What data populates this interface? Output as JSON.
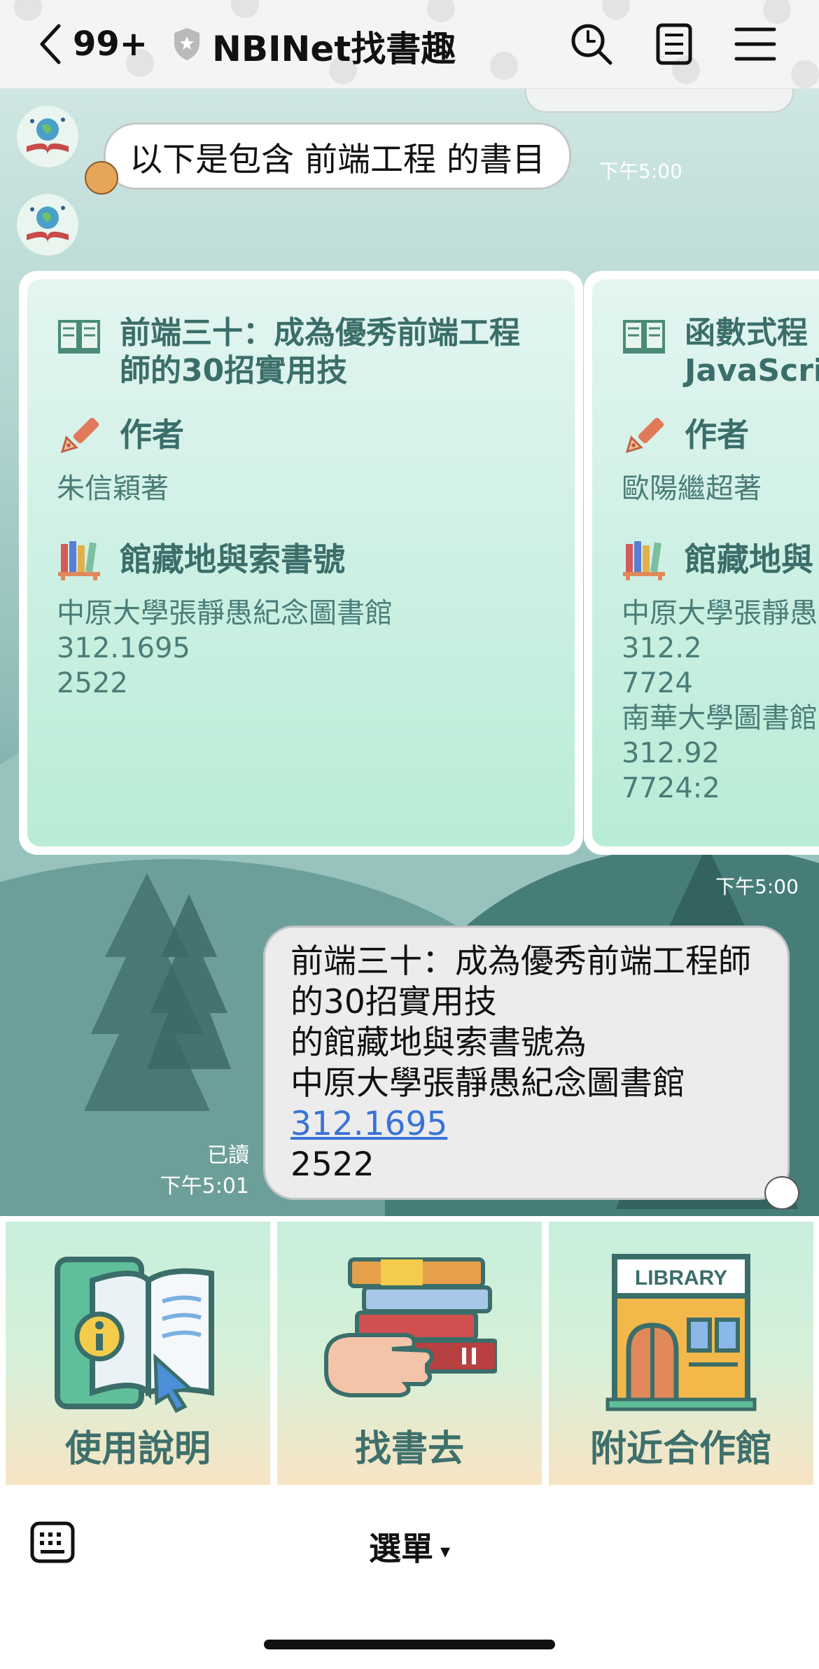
{
  "header": {
    "unread_count": "99+",
    "title": "NBINet找書趣"
  },
  "chat": {
    "bot_message": "以下是包含 前端工程 的書目",
    "bot_message_time": "下午5:00",
    "carousel_time": "下午5:00",
    "cards": [
      {
        "title": "前端三十：成為優秀前端工程師的30招實用技",
        "author_label": "作者",
        "author": "朱信穎著",
        "holdings_label": "館藏地與索書號",
        "holdings": [
          "中原大學張靜愚紀念圖書館",
          "312.1695",
          "2522"
        ]
      },
      {
        "title": "函數式程",
        "title_line2": "JavaScrip",
        "author_label": "作者",
        "author": "歐陽繼超著",
        "holdings_label": "館藏地與",
        "holdings": [
          "中原大學張靜愚",
          "312.2",
          "7724",
          "南華大學圖書館",
          "312.92",
          "7724:2"
        ]
      }
    ],
    "sent_message": {
      "lines": [
        "前端三十：成為優秀前端工程師",
        "的30招實用技",
        "的館藏地與索書號為",
        "中原大學張靜愚紀念圖書館"
      ],
      "link": "312.1695",
      "last_line": "2522"
    },
    "read_status": "已讀",
    "sent_time": "下午5:01"
  },
  "rich_menu": {
    "items": [
      {
        "label": "使用說明",
        "icon": "manual-icon"
      },
      {
        "label": "找書去",
        "icon": "books-hand-icon"
      },
      {
        "label": "附近合作館",
        "icon": "library-icon",
        "sign": "LIBRARY"
      }
    ]
  },
  "bottom_bar": {
    "menu_label": "選單",
    "caret": "▾"
  }
}
